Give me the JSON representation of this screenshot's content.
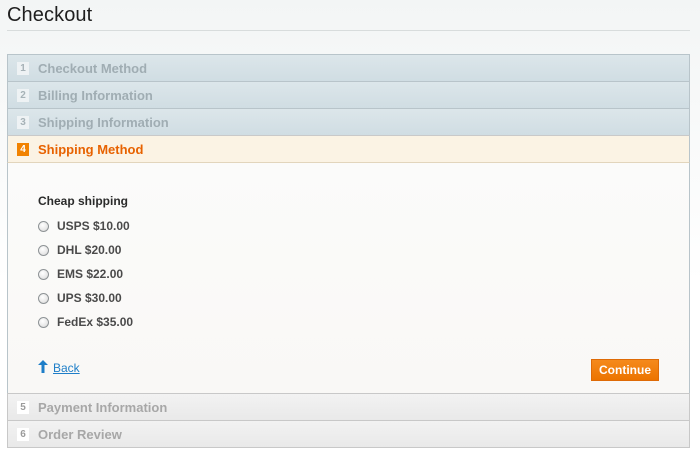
{
  "page": {
    "title": "Checkout"
  },
  "steps": [
    {
      "number": "1",
      "label": "Checkout Method"
    },
    {
      "number": "2",
      "label": "Billing Information"
    },
    {
      "number": "3",
      "label": "Shipping Information"
    },
    {
      "number": "4",
      "label": "Shipping Method"
    },
    {
      "number": "5",
      "label": "Payment Information"
    },
    {
      "number": "6",
      "label": "Order Review"
    }
  ],
  "shipping_method": {
    "group_title": "Cheap shipping",
    "options": [
      {
        "label": "USPS $10.00"
      },
      {
        "label": "DHL $20.00"
      },
      {
        "label": "EMS $22.00"
      },
      {
        "label": "UPS $30.00"
      },
      {
        "label": "FedEx $35.00"
      }
    ],
    "back_label": "Back",
    "back_icon": "arrow-up-icon",
    "continue_label": "Continue"
  },
  "colors": {
    "accent": "#f18200",
    "active_label": "#e76200",
    "link": "#1e7ec8"
  }
}
